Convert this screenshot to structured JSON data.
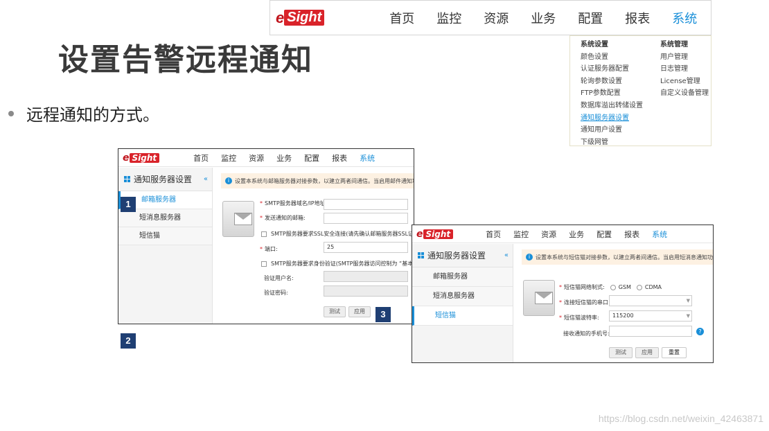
{
  "slide": {
    "title": "设置告警远程通知",
    "bullet": "远程通知的方式。",
    "watermark": "https://blog.csdn.net/weixin_42463871"
  },
  "logo": {
    "e": "e",
    "sight": "Sight"
  },
  "top_nav": {
    "items": [
      "首页",
      "监控",
      "资源",
      "业务",
      "配置",
      "报表",
      "系统"
    ],
    "active": "系统"
  },
  "dropdown": {
    "col1_header": "系统设置",
    "col1_items": [
      "颜色设置",
      "认证服务器配置",
      "轮询参数设置",
      "FTP参数配置",
      "数据库溢出转储设置",
      "通知服务器设置",
      "通知用户设置",
      "下级网管"
    ],
    "col2_header": "系统管理",
    "col2_items": [
      "用户管理",
      "日志管理",
      "License管理",
      "自定义设备管理"
    ]
  },
  "shot1": {
    "sidebar_title": "通知服务器设置",
    "sidebar_items": [
      "邮箱服务器",
      "短消息服务器",
      "短信猫"
    ],
    "info": "设置本系统与邮箱服务器对接参数，以建立两者间通信。当启用邮件通知功能后",
    "smtp_label": "SMTP服务器域名/IP地址:",
    "mail_label": "发送通知的邮箱:",
    "ssl_label": "SMTP服务器要求SSL安全连接(请先确认邮箱服务器SSL证书已",
    "port_label": "端口:",
    "port_value": "25",
    "auth_label": "SMTP服务器要求身份验证(SMTP服务器访问控制为 “基本身份",
    "user_label": "验证用户名:",
    "pwd_label": "验证密码:",
    "test_btn": "测试",
    "apply_btn": "应用"
  },
  "shot2": {
    "sidebar_title": "通知服务器设置",
    "sidebar_items": [
      "邮箱服务器",
      "短消息服务器",
      "短信猫"
    ],
    "info": "设置本系统与短信猫对接参数，以建立两者间通信。当启用短消息通知功能",
    "network_label": "短信猫网络制式:",
    "gsm": "GSM",
    "cdma": "CDMA",
    "port_label": "连接短信猫的串口:",
    "baud_label": "短信猫波特率:",
    "baud_value": "115200",
    "phone_label": "接收通知的手机号:",
    "test_btn": "测试",
    "apply_btn": "应用",
    "reset_btn": "重置"
  },
  "markers": [
    "1",
    "2",
    "3"
  ]
}
